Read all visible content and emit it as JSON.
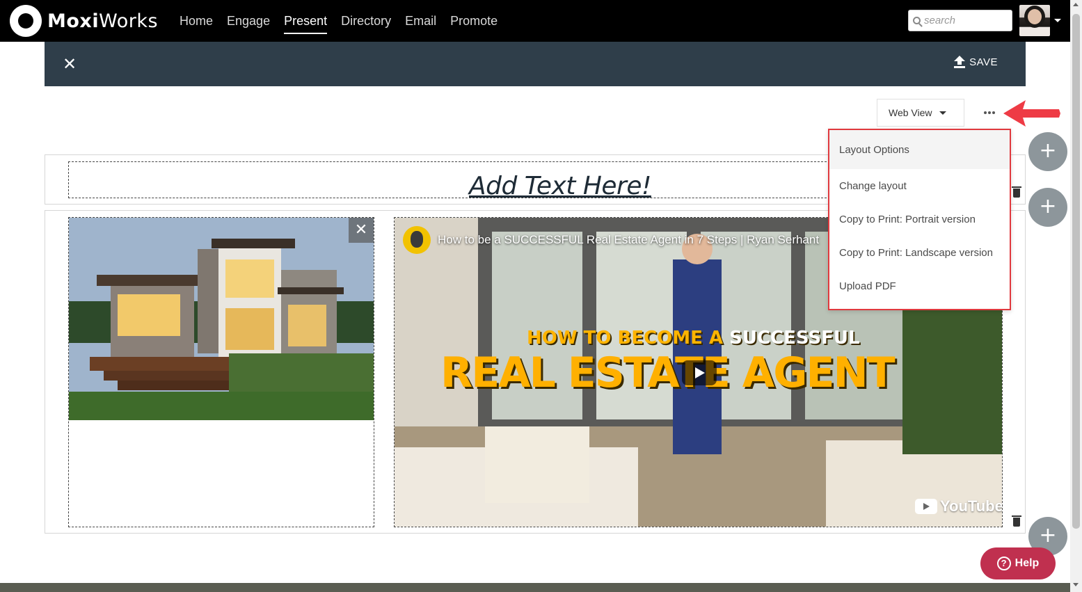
{
  "brand": {
    "name_bold": "Moxi",
    "name_rest": "Works"
  },
  "nav": {
    "items": [
      {
        "label": "Home",
        "active": false
      },
      {
        "label": "Engage",
        "active": false
      },
      {
        "label": "Present",
        "active": true
      },
      {
        "label": "Directory",
        "active": false
      },
      {
        "label": "Email",
        "active": false
      },
      {
        "label": "Promote",
        "active": false
      }
    ],
    "search_placeholder": "search"
  },
  "editor": {
    "close_icon": "close-icon",
    "save_label": "SAVE",
    "view_select": "Web View"
  },
  "content": {
    "heading": "Add Text Here!",
    "video": {
      "title": "How to be a SUCCESSFUL Real Estate Agent in 7 Steps | Ryan Serhant",
      "tag_line1_a": "HOW TO BECOME A ",
      "tag_line1_b": "SUCCESSFUL",
      "tag_line2": "REAL ESTATE AGENT",
      "platform": "YouTube"
    }
  },
  "menu": {
    "header": "Layout Options",
    "items": [
      "Change layout",
      "Copy to Print: Portrait version",
      "Copy to Print: Landscape version",
      "Upload PDF"
    ]
  },
  "help_label": "Help",
  "colors": {
    "nav_bg": "#000000",
    "editor_bar": "#2f3e4a",
    "highlight": "#e0393e",
    "help": "#c0304f",
    "plus_button": "#8d969b"
  }
}
